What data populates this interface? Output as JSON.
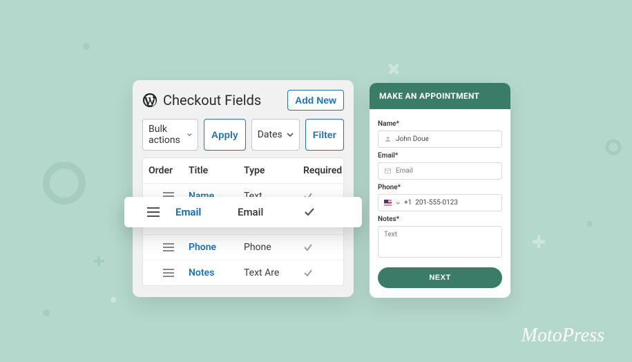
{
  "admin": {
    "title": "Checkout Fields",
    "add_new": "Add New",
    "bulk_actions": "Bulk actions",
    "apply": "Apply",
    "dates": "Dates",
    "filter": "Filter",
    "columns": {
      "order": "Order",
      "title": "Title",
      "type": "Type",
      "required": "Required"
    },
    "rows": [
      {
        "title": "Name",
        "type": "Text"
      },
      {
        "title": "Email",
        "type": "Email"
      },
      {
        "title": "Phone",
        "type": "Phone"
      },
      {
        "title": "Notes",
        "type": "Text Are"
      }
    ]
  },
  "highlight": {
    "title": "Email",
    "type": "Email"
  },
  "appointment": {
    "heading": "MAKE AN APPOINTMENT",
    "name_label": "Name*",
    "name_value": "John Doue",
    "email_label": "Email*",
    "email_placeholder": "Email",
    "phone_label": "Phone*",
    "phone_value": "+1  201-555-0123",
    "notes_label": "Notes*",
    "notes_placeholder": "Text",
    "next": "NEXT"
  },
  "brand": "MotoPress"
}
